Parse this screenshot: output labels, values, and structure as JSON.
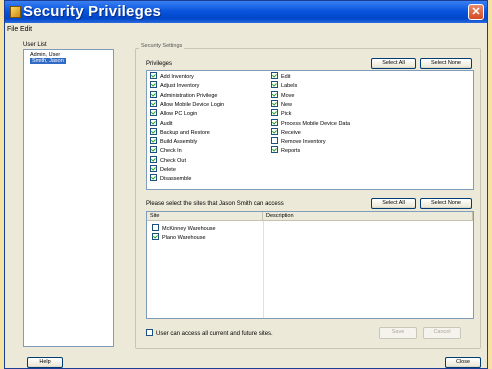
{
  "window": {
    "title": "Security Privileges"
  },
  "menu": {
    "file": "File",
    "edit": "Edit"
  },
  "user_list": {
    "label": "User List",
    "users": [
      "Admin, User",
      "Smith, Jason"
    ],
    "selected_index": 1
  },
  "security": {
    "group_label": "Security Settings",
    "privileges_label": "Privileges",
    "select_all": "Select All",
    "select_none": "Select None",
    "privileges_col1": [
      {
        "label": "Add Inventory",
        "checked": true
      },
      {
        "label": "Adjust Inventory",
        "checked": true
      },
      {
        "label": "Administration Privilege",
        "checked": true
      },
      {
        "label": "Allow Mobile Device Login",
        "checked": true
      },
      {
        "label": "Allow PC Login",
        "checked": true
      },
      {
        "label": "Audit",
        "checked": true
      },
      {
        "label": "Backup and Restore",
        "checked": true
      },
      {
        "label": "Build Assembly",
        "checked": true
      },
      {
        "label": "Check In",
        "checked": true
      },
      {
        "label": "Check Out",
        "checked": true
      },
      {
        "label": "Delete",
        "checked": true
      },
      {
        "label": "Disassemble",
        "checked": true
      }
    ],
    "privileges_col2": [
      {
        "label": "Edit",
        "checked": true
      },
      {
        "label": "Labels",
        "checked": true
      },
      {
        "label": "Move",
        "checked": true
      },
      {
        "label": "New",
        "checked": true
      },
      {
        "label": "Pick",
        "checked": true
      },
      {
        "label": "Process Mobile Device Data",
        "checked": true
      },
      {
        "label": "Receive",
        "checked": true
      },
      {
        "label": "Remove Inventory",
        "checked": false
      },
      {
        "label": "Reports",
        "checked": true
      }
    ],
    "sites_prompt": "Please select the sites that Jason Smith can access",
    "sites_select_all": "Select All",
    "sites_select_none": "Select None",
    "sites_columns": [
      "Site",
      "Description"
    ],
    "sites": [
      {
        "name": "McKinney Warehouse",
        "checked": false
      },
      {
        "name": "Plano Warehouse",
        "checked": true
      }
    ],
    "all_sites_label": "User can access all current and future sites.",
    "all_sites_checked": false,
    "save": "Save",
    "cancel": "Cancel"
  },
  "footer": {
    "help": "Help",
    "close": "Close"
  }
}
